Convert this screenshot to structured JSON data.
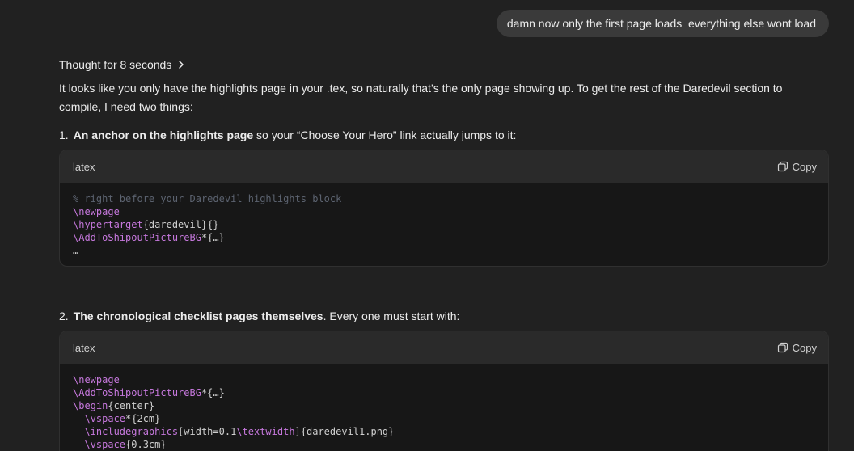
{
  "user_message": "damn now only the first page loads  everything else wont load",
  "thought": {
    "label": "Thought for 8 seconds"
  },
  "intro": "It looks like you only have the highlights page in your .tex, so naturally that’s the only page showing up. To get the rest of the Daredevil section to compile, I need two things:",
  "items": [
    {
      "num": "1.",
      "bold": "An anchor on the highlights page",
      "rest": " so your “Choose Your Hero” link actually jumps to it:"
    },
    {
      "num": "2.",
      "bold": "The chronological checklist pages themselves",
      "rest": ". Every one must start with:"
    }
  ],
  "code_blocks": [
    {
      "lang": "latex",
      "copy_label": "Copy",
      "lines": [
        [
          {
            "t": "comment",
            "s": "% right before your Daredevil highlights block"
          }
        ],
        [
          {
            "t": "cmd",
            "s": "\\newpage"
          }
        ],
        [
          {
            "t": "cmd",
            "s": "\\hypertarget"
          },
          {
            "t": "plain",
            "s": "{daredevil}{}"
          }
        ],
        [
          {
            "t": "cmd",
            "s": "\\AddToShipoutPictureBG"
          },
          {
            "t": "plain",
            "s": "*{…}"
          }
        ],
        [
          {
            "t": "plain",
            "s": "…"
          }
        ]
      ]
    },
    {
      "lang": "latex",
      "copy_label": "Copy",
      "lines": [
        [
          {
            "t": "cmd",
            "s": "\\newpage"
          }
        ],
        [
          {
            "t": "cmd",
            "s": "\\AddToShipoutPictureBG"
          },
          {
            "t": "plain",
            "s": "*{…}"
          }
        ],
        [
          {
            "t": "cmd",
            "s": "\\begin"
          },
          {
            "t": "plain",
            "s": "{center}"
          }
        ],
        [
          {
            "t": "plain",
            "s": "  "
          },
          {
            "t": "cmd",
            "s": "\\vspace"
          },
          {
            "t": "plain",
            "s": "*{2cm}"
          }
        ],
        [
          {
            "t": "plain",
            "s": "  "
          },
          {
            "t": "cmd",
            "s": "\\includegraphics"
          },
          {
            "t": "plain",
            "s": "[width=0.1"
          },
          {
            "t": "cmd",
            "s": "\\textwidth"
          },
          {
            "t": "plain",
            "s": "]{daredevil1.png}"
          }
        ],
        [
          {
            "t": "plain",
            "s": "  "
          },
          {
            "t": "cmd",
            "s": "\\vspace"
          },
          {
            "t": "plain",
            "s": "{0.3cm}"
          }
        ]
      ]
    }
  ]
}
